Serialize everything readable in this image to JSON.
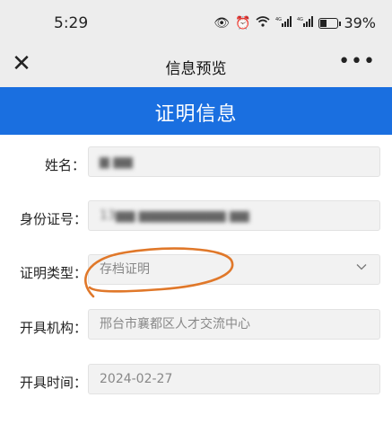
{
  "status_bar": {
    "time": "5:29",
    "battery_pct": "39%",
    "battery_level": 0.39,
    "icons": [
      "eye-icon",
      "alarm-icon",
      "wifi-icon",
      "signal-4g-icon",
      "signal-4g-icon",
      "battery-icon"
    ]
  },
  "nav": {
    "title": "信息预览",
    "close_icon": "close-icon",
    "more_icon": "more-icon"
  },
  "header": {
    "title": "证明信息",
    "color": "#1a6fe0"
  },
  "form": {
    "name": {
      "label": "姓名：",
      "value": ""
    },
    "id_number": {
      "label": "身份证号：",
      "value": ""
    },
    "cert_type": {
      "label": "证明类型：",
      "value": "存档证明"
    },
    "issuer": {
      "label": "开具机构：",
      "value": "邢台市襄都区人才交流中心"
    },
    "issue_time": {
      "label": "开具时间：",
      "value": "2024-02-27"
    }
  },
  "annotation": {
    "color": "#e0782a"
  }
}
